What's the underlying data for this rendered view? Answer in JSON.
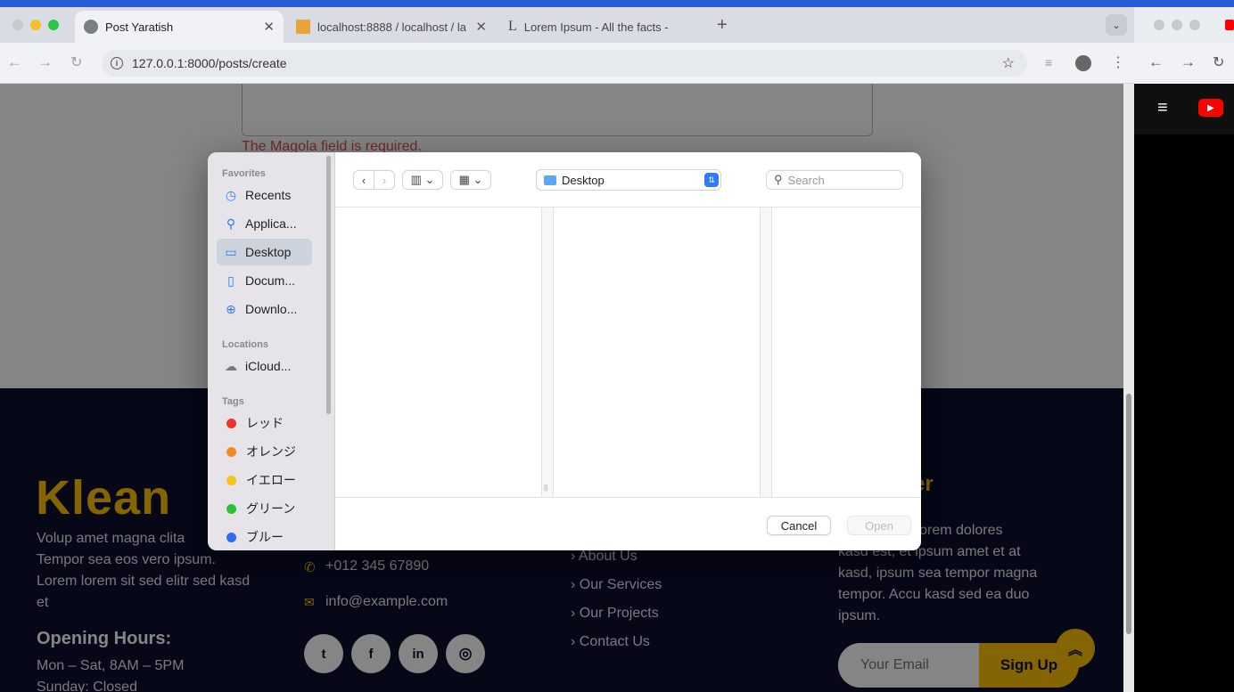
{
  "browser": {
    "tabs": [
      {
        "title": "Post Yaratish",
        "active": true
      },
      {
        "title": "localhost:8888 / localhost / la",
        "active": false
      },
      {
        "title": "Lorem Ipsum - All the facts - ",
        "active": false
      }
    ],
    "new_tab_label": "+",
    "url": "127.0.0.1:8000/posts/create"
  },
  "page": {
    "error_text": "The Magola field is required.",
    "footer": {
      "brand": "Klean",
      "about_lines": [
        "Volup amet magna clita",
        "Tempor sea eos vero ipsum.",
        "Lorem lorem sit sed elitr sed kasd",
        "et"
      ],
      "hours_title": "Opening Hours:",
      "hours_weekday": "Mon – Sat, 8AM – 5PM",
      "hours_sunday": "Sunday: Closed",
      "phone": "+012 345 67890",
      "email": "info@example.com",
      "social": [
        "twitter",
        "facebook",
        "linkedin",
        "instagram"
      ],
      "links": [
        "About Us",
        "Our Services",
        "Our Projects",
        "Contact Us"
      ],
      "newsletter_title_partial": "tter",
      "newsletter_lines": [
        "ore lorem dolores",
        "kasd est, et ipsum amet et at",
        "kasd, ipsum sea tempor magna",
        "tempor. Accu kasd sed ea duo",
        "ipsum."
      ],
      "email_placeholder": "Your Email",
      "signup_label": "Sign Up"
    }
  },
  "dialog": {
    "favorites_label": "Favorites",
    "favorites": [
      {
        "label": "Recents",
        "icon": "clock-icon"
      },
      {
        "label": "Applica...",
        "icon": "apps-icon"
      },
      {
        "label": "Desktop",
        "icon": "desktop-icon",
        "selected": true
      },
      {
        "label": "Docum...",
        "icon": "document-icon"
      },
      {
        "label": "Downlo...",
        "icon": "download-icon"
      }
    ],
    "locations_label": "Locations",
    "locations": [
      {
        "label": "iCloud...",
        "icon": "cloud-icon"
      }
    ],
    "tags_label": "Tags",
    "tags": [
      {
        "label": "レッド",
        "color": "#f5312c"
      },
      {
        "label": "オレンジ",
        "color": "#f08a24"
      },
      {
        "label": "イエロー",
        "color": "#f5c518"
      },
      {
        "label": "グリーン",
        "color": "#2ebf3a"
      },
      {
        "label": "ブルー",
        "color": "#2f6cf6"
      }
    ],
    "location": "Desktop",
    "search_placeholder": "Search",
    "cancel_label": "Cancel",
    "open_label": "Open"
  }
}
